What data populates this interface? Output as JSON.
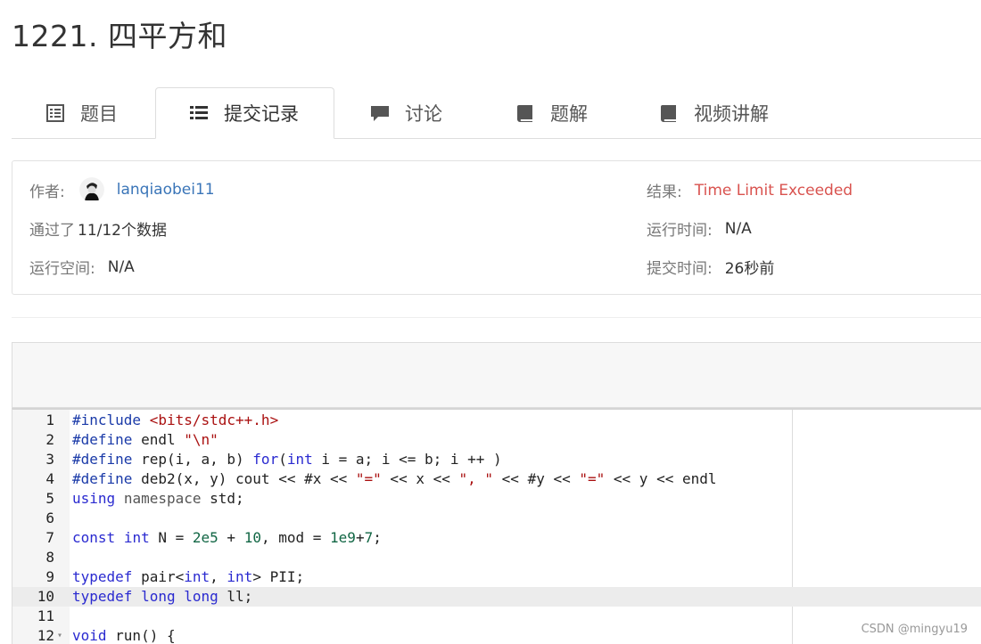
{
  "problem": {
    "title": "1221. 四平方和"
  },
  "tabs": [
    {
      "label": "题目",
      "icon": "list-alt-icon"
    },
    {
      "label": "提交记录",
      "icon": "list-icon",
      "active": true
    },
    {
      "label": "讨论",
      "icon": "comment-icon"
    },
    {
      "label": "题解",
      "icon": "book-icon"
    },
    {
      "label": "视频讲解",
      "icon": "book-icon"
    }
  ],
  "submission": {
    "author_label": "作者:",
    "author_name": "lanqiaobei11",
    "passed_prefix": "通过了",
    "passed_value": "11/12个数据",
    "space_label": "运行空间:",
    "space_value": "N/A",
    "result_label": "结果:",
    "result_value": "Time Limit Exceeded",
    "runtime_label": "运行时间:",
    "runtime_value": "N/A",
    "submit_time_label": "提交时间:",
    "submit_time_value": "26秒前"
  },
  "code": {
    "highlighted_line": 10,
    "lines": [
      {
        "n": "1",
        "text": "#include <bits/stdc++.h>"
      },
      {
        "n": "2",
        "text": "#define endl \"\\n\""
      },
      {
        "n": "3",
        "text": "#define rep(i, a, b) for(int i = a; i <= b; i ++ )"
      },
      {
        "n": "4",
        "text": "#define deb2(x, y) cout << #x << \"=\" << x << \", \" << #y << \"=\" << y << endl"
      },
      {
        "n": "5",
        "text": "using namespace std;"
      },
      {
        "n": "6",
        "text": ""
      },
      {
        "n": "7",
        "text": "const int N = 2e5 + 10, mod = 1e9+7;"
      },
      {
        "n": "8",
        "text": ""
      },
      {
        "n": "9",
        "text": "typedef pair<int, int> PII;"
      },
      {
        "n": "10",
        "text": "typedef long long ll;"
      },
      {
        "n": "11",
        "text": ""
      },
      {
        "n": "12",
        "text": "void run() {"
      }
    ]
  },
  "watermark": "CSDN @mingyu19"
}
